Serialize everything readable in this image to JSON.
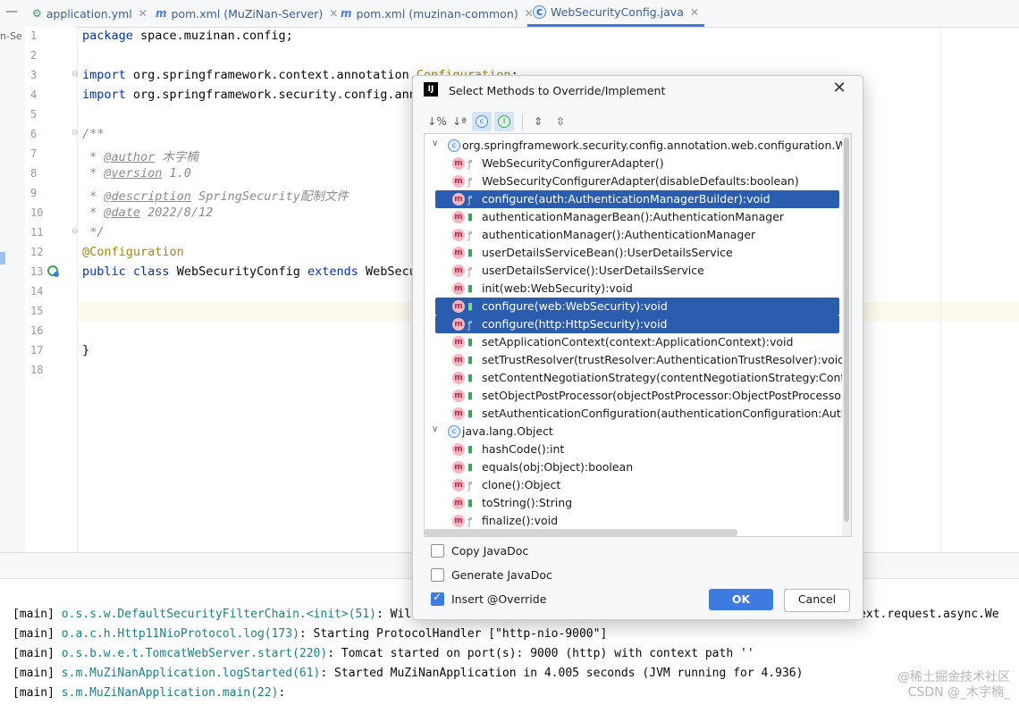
{
  "tabs": [
    {
      "label": "application.yml",
      "icon": "yml-file-icon"
    },
    {
      "label": "pom.xml (MuZiNan-Server)",
      "icon": "maven-icon"
    },
    {
      "label": "pom.xml (muzinan-common)",
      "icon": "maven-icon"
    },
    {
      "label": "WebSecurityConfig.java",
      "icon": "java-class-icon"
    }
  ],
  "project_strip_label": "n-Se",
  "line_numbers": [
    "1",
    "2",
    "3",
    "4",
    "5",
    "6",
    "7",
    "8",
    "9",
    "10",
    "11",
    "12",
    "13",
    "14",
    "15",
    "16",
    "17",
    "18"
  ],
  "code": {
    "l1_kw": "package",
    "l1_rest": " space.muzinan.config;",
    "l3_kw": "import",
    "l3_rest": " org.springframework.context.annotation.",
    "l3_ann": "Configuration",
    "l3_end": ";",
    "l4_kw": "import",
    "l4_rest": " org.springframework.security.config.ann",
    "l6": "/**",
    "l7_pre": " * ",
    "l7_tag": "@author",
    "l7_val": " 木字楠",
    "l8_pre": " * ",
    "l8_tag": "@version",
    "l8_val": " 1.0",
    "l9_pre": " * ",
    "l9_tag": "@description",
    "l9_val": " SpringSecurity配制文件",
    "l10_pre": " * ",
    "l10_tag": "@date",
    "l10_val": " 2022/8/12",
    "l11": " */",
    "l12": "@Configuration",
    "l13_kw1": "public",
    "l13_kw2": "class",
    "l13_name": " WebSecurityConfig ",
    "l13_kw3": "extends",
    "l13_rest": " WebSecu",
    "l17": "}"
  },
  "dialog": {
    "title": "Select Methods to Override/Implement",
    "close": "✕",
    "toolbar": [
      "sort-visibility-icon",
      "sort-alpha-icon",
      "show-classes-icon",
      "show-interfaces-icon",
      "expand-all-icon",
      "collapse-all-icon"
    ],
    "groups": [
      {
        "name": "org.springframework.security.config.annotation.web.configuration.WebSec",
        "methods": [
          {
            "sig": "WebSecurityConfigurerAdapter()",
            "access": "protected",
            "selected": false
          },
          {
            "sig": "WebSecurityConfigurerAdapter(disableDefaults:boolean)",
            "access": "protected",
            "selected": false
          },
          {
            "sig": "configure(auth:AuthenticationManagerBuilder):void",
            "access": "protected",
            "selected": true
          },
          {
            "sig": "authenticationManagerBean():AuthenticationManager",
            "access": "public",
            "selected": false
          },
          {
            "sig": "authenticationManager():AuthenticationManager",
            "access": "protected",
            "selected": false
          },
          {
            "sig": "userDetailsServiceBean():UserDetailsService",
            "access": "public",
            "selected": false
          },
          {
            "sig": "userDetailsService():UserDetailsService",
            "access": "protected",
            "selected": false
          },
          {
            "sig": "init(web:WebSecurity):void",
            "access": "public",
            "selected": false
          },
          {
            "sig": "configure(web:WebSecurity):void",
            "access": "public",
            "selected": true
          },
          {
            "sig": "configure(http:HttpSecurity):void",
            "access": "protected",
            "selected": true
          },
          {
            "sig": "setApplicationContext(context:ApplicationContext):void",
            "access": "public",
            "selected": false
          },
          {
            "sig": "setTrustResolver(trustResolver:AuthenticationTrustResolver):void",
            "access": "public",
            "selected": false
          },
          {
            "sig": "setContentNegotiationStrategy(contentNegotiationStrategy:ContentNe",
            "access": "public",
            "selected": false
          },
          {
            "sig": "setObjectPostProcessor(objectPostProcessor:ObjectPostProcessor<C",
            "access": "public",
            "selected": false
          },
          {
            "sig": "setAuthenticationConfiguration(authenticationConfiguration:Authentica",
            "access": "public",
            "selected": false
          }
        ]
      },
      {
        "name": "java.lang.Object",
        "methods": [
          {
            "sig": "hashCode():int",
            "access": "public",
            "selected": false
          },
          {
            "sig": "equals(obj:Object):boolean",
            "access": "public",
            "selected": false
          },
          {
            "sig": "clone():Object",
            "access": "protected",
            "selected": false
          },
          {
            "sig": "toString():String",
            "access": "public",
            "selected": false
          },
          {
            "sig": "finalize():void",
            "access": "protected",
            "selected": false
          }
        ]
      }
    ],
    "options": [
      {
        "label": "Copy JavaDoc",
        "checked": false
      },
      {
        "label": "Generate JavaDoc",
        "checked": false
      },
      {
        "label": "Insert @Override",
        "checked": true
      }
    ],
    "ok": "OK",
    "cancel": "Cancel"
  },
  "console": [
    {
      "thread": "[main] ",
      "cls": "o.s.s.w.DefaultSecurityFilterChain.<init>(51)",
      "msg": ": Will secure any request with [org.springframework.security.web.context.request.async.We"
    },
    {
      "thread": "[main] ",
      "cls": "o.a.c.h.Http11NioProtocol.log(173)",
      "msg": ": Starting ProtocolHandler [\"http-nio-9000\"]"
    },
    {
      "thread": "[main] ",
      "cls": "o.s.b.w.e.t.TomcatWebServer.start(220)",
      "msg": ": Tomcat started on port(s): 9000 (http) with context path ''"
    },
    {
      "thread": "[main] ",
      "cls": "s.m.MuZiNanApplication.logStarted(61)",
      "msg": ": Started MuZiNanApplication in 4.005 seconds (JVM running for 4.936)"
    },
    {
      "thread": "[main] ",
      "cls": "s.m.MuZiNanApplication.main(22)",
      "msg": ":"
    }
  ],
  "watermark": [
    "@稀土掘金技术社区",
    "CSDN @_木字楠_"
  ]
}
